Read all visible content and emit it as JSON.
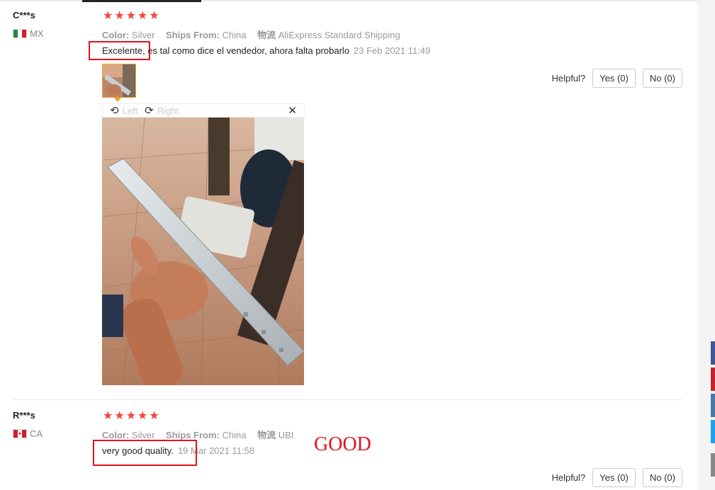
{
  "reviews": [
    {
      "user": "C***s",
      "country": "MX",
      "flag_colors": [
        "#1e8a3c",
        "#ffffff",
        "#d21e2d"
      ],
      "rating": 5,
      "color_label": "Color:",
      "color_value": "Silver",
      "ships_label": "Ships From:",
      "ships_value": "China",
      "logistics_label": "物流",
      "logistics_value": "AliExpress Standard Shipping",
      "text": "Excelente, es tal como dice el vendedor, ahora falta probarlo",
      "date": "23 Feb 2021 11:49",
      "helpful_label": "Helpful?",
      "yes_label": "Yes (0)",
      "no_label": "No (0)",
      "viewer": {
        "left_label": "Left",
        "right_label": "Right"
      }
    },
    {
      "user": "R***s",
      "country": "CA",
      "flag_colors": [
        "#d21e2d",
        "#ffffff",
        "#d21e2d"
      ],
      "rating": 5,
      "color_label": "Color:",
      "color_value": "Silver",
      "ships_label": "Ships From:",
      "ships_value": "China",
      "logistics_label": "物流",
      "logistics_value": "UBI",
      "text": "very good quality.",
      "date": "19 Mar 2021 11:58",
      "helpful_label": "Helpful?",
      "yes_label": "Yes (0)",
      "no_label": "No (0)"
    }
  ],
  "annotation": {
    "text": "GOOD",
    "color": "#e0141e"
  },
  "share_colors": [
    "#3b5998",
    "#c4232b",
    "#4a76a8",
    "#1da1f2",
    "#888888"
  ],
  "star_color": "#f44336"
}
